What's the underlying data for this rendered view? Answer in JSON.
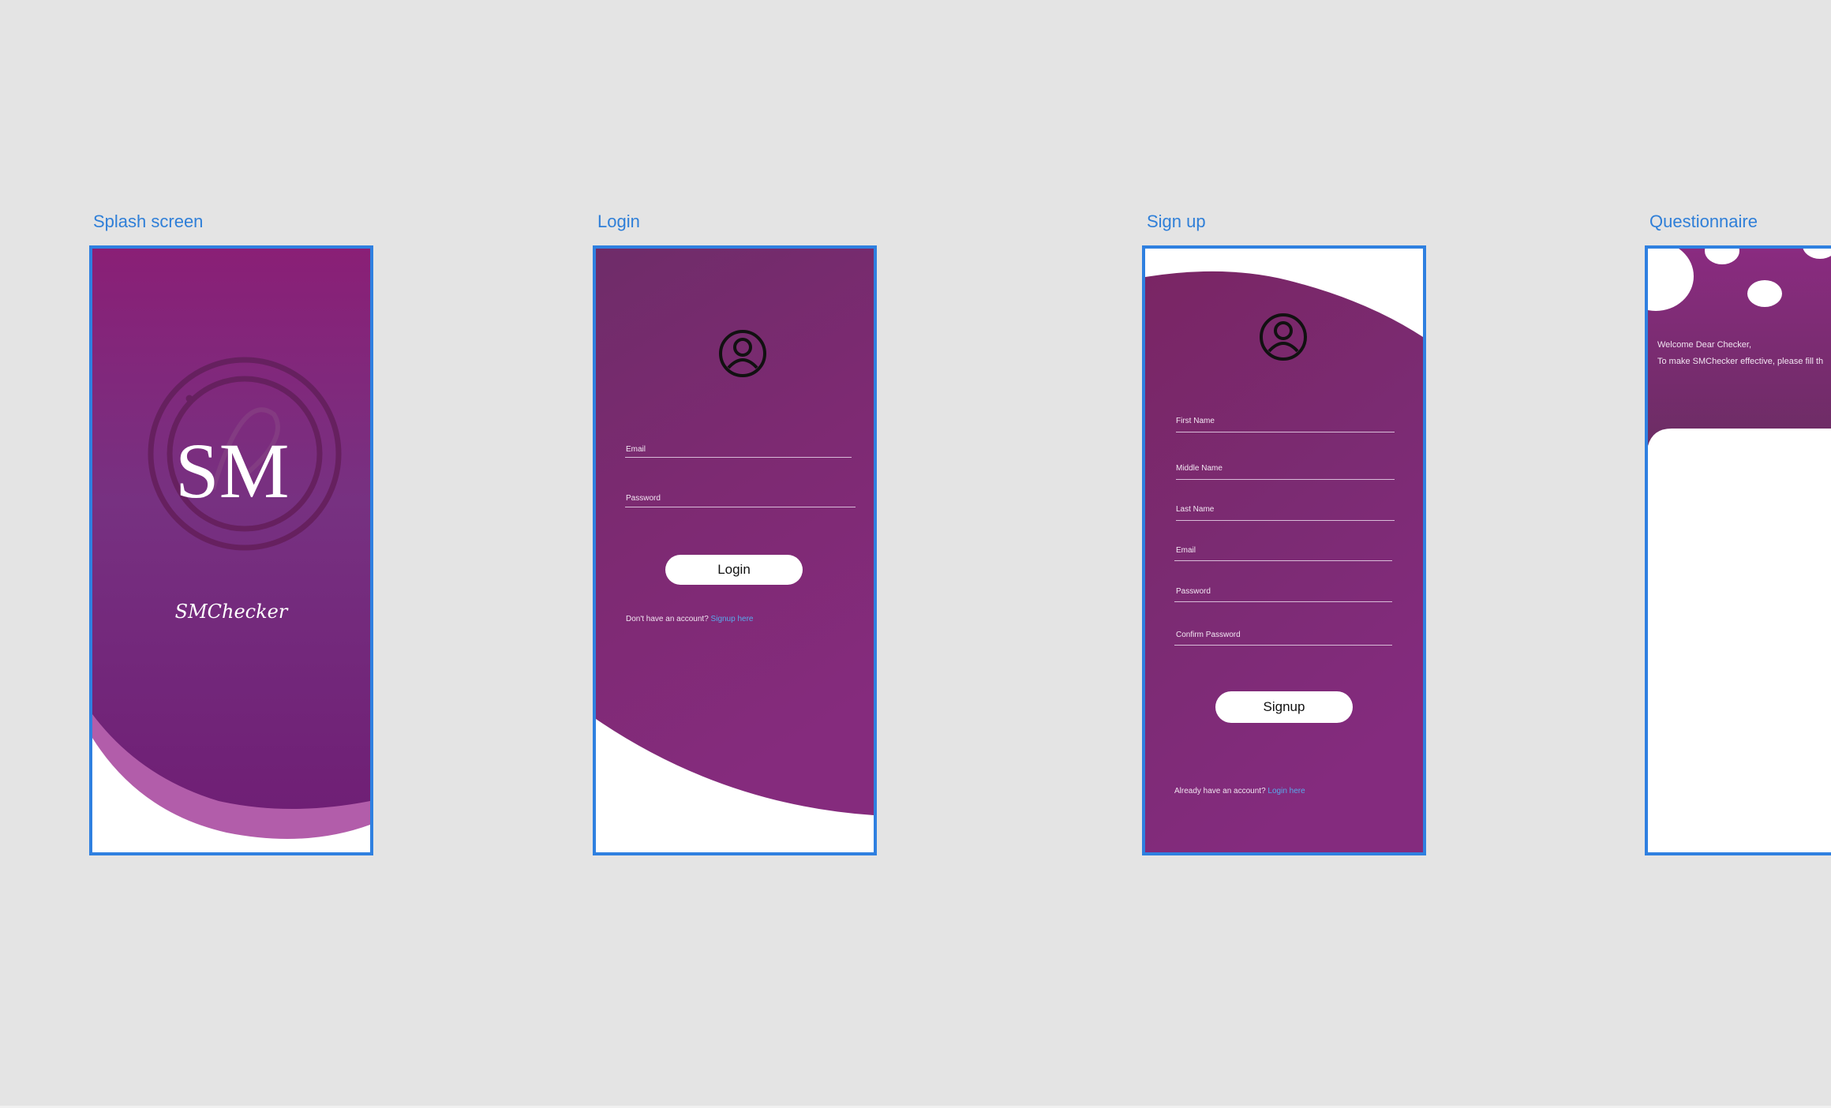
{
  "boards": {
    "splash": {
      "title": "Splash screen",
      "logo_text": "SM",
      "app_name": "SMChecker"
    },
    "login": {
      "title": "Login",
      "email_label": "Email",
      "password_label": "Password",
      "login_button": "Login",
      "footer_text": "Don't have an account?",
      "footer_link": "Signup here"
    },
    "signup": {
      "title": "Sign up",
      "first_name_label": "First Name",
      "middle_name_label": "Middle Name",
      "last_name_label": "Last Name",
      "email_label": "Email",
      "password_label": "Password",
      "confirm_password_label": "Confirm Password",
      "signup_button": "Signup",
      "footer_text": "Already have an account?",
      "footer_link": "Login here"
    },
    "questionnaire": {
      "title": "Questionnaire",
      "welcome_line": "Welcome Dear Checker,",
      "intro_line": "To make SMChecker effective, please fill th"
    }
  },
  "icons": [
    "user-circle-icon",
    "sm-logo"
  ],
  "colors": {
    "canvas": "#e4e4e4",
    "frame_border": "#2f80e0",
    "board_title": "#2f7fd8",
    "purple_top": "#8a2077",
    "purple_mid": "#733282",
    "purple_light": "#b25daa",
    "link": "#58a9ec"
  }
}
